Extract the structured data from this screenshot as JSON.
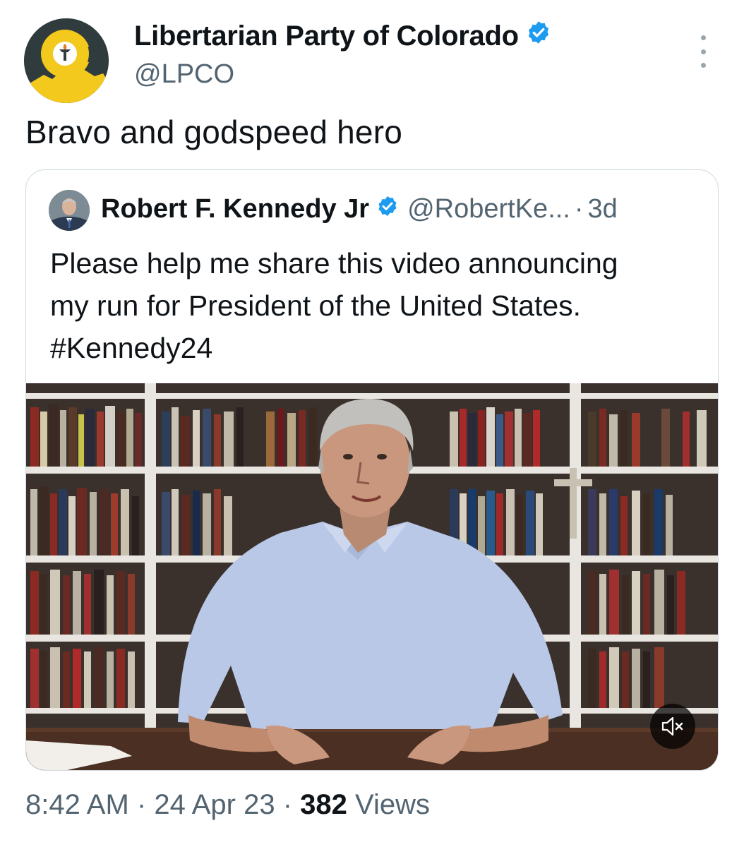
{
  "tweet": {
    "author_name": "Libertarian Party of Colorado",
    "author_handle": "@LPCO",
    "text": "Bravo and godspeed hero",
    "timestamp_time": "8:42 AM",
    "timestamp_date": "24 Apr 23",
    "views_count": "382",
    "views_label": "Views",
    "separator": "·"
  },
  "quote": {
    "author_name": "Robert F. Kennedy Jr",
    "author_handle": "@RobertKe...",
    "age": "3d",
    "text_lines": [
      "Please help me share this video announcing",
      "my run for President of the United States.",
      "#Kennedy24"
    ]
  },
  "colors": {
    "verified": "#1d9bf0",
    "handle": "#536471",
    "text": "#0f1419",
    "border": "#cfd9de",
    "logo_yellow": "#f2c91c",
    "logo_dark": "#2f3b3d"
  },
  "icons": {
    "verified": "verified-badge-icon",
    "more": "more-options-icon",
    "mute": "muted-speaker-icon"
  }
}
